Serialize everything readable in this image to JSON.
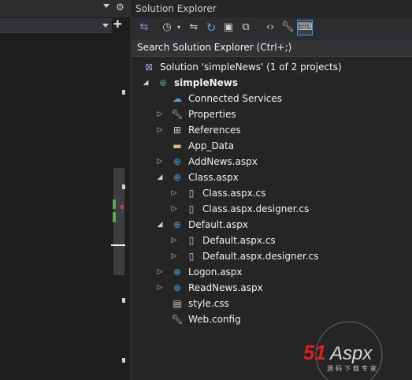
{
  "panel": {
    "title": "Solution Explorer",
    "search_placeholder": "Search Solution Explorer (Ctrl+;)"
  },
  "tree": [
    {
      "label": "Solution 'simpleNews' (1 of 2 projects)",
      "icon": "solution-icon",
      "level": 0,
      "expander": "none",
      "bold": false
    },
    {
      "label": "simpleNews",
      "icon": "web-project-icon",
      "level": 1,
      "expander": "expanded",
      "bold": true
    },
    {
      "label": "Connected Services",
      "icon": "connected-services-icon",
      "level": 2,
      "expander": "none",
      "bold": false
    },
    {
      "label": "Properties",
      "icon": "wrench-icon",
      "level": 2,
      "expander": "collapsed",
      "bold": false
    },
    {
      "label": "References",
      "icon": "references-icon",
      "level": 2,
      "expander": "collapsed",
      "bold": false
    },
    {
      "label": "App_Data",
      "icon": "folder-icon",
      "level": 2,
      "expander": "none",
      "bold": false
    },
    {
      "label": "AddNews.aspx",
      "icon": "web-file-icon",
      "level": 2,
      "expander": "collapsed",
      "bold": false
    },
    {
      "label": "Class.aspx",
      "icon": "web-file-icon",
      "level": 2,
      "expander": "expanded",
      "bold": false
    },
    {
      "label": "Class.aspx.cs",
      "icon": "cs-file-icon",
      "level": 3,
      "expander": "collapsed",
      "bold": false
    },
    {
      "label": "Class.aspx.designer.cs",
      "icon": "cs-file-icon",
      "level": 3,
      "expander": "collapsed",
      "bold": false
    },
    {
      "label": "Default.aspx",
      "icon": "web-file-icon",
      "level": 2,
      "expander": "expanded",
      "bold": false
    },
    {
      "label": "Default.aspx.cs",
      "icon": "cs-file-icon",
      "level": 3,
      "expander": "collapsed",
      "bold": false
    },
    {
      "label": "Default.aspx.designer.cs",
      "icon": "cs-file-icon",
      "level": 3,
      "expander": "collapsed",
      "bold": false
    },
    {
      "label": "Logon.aspx",
      "icon": "web-file-icon",
      "level": 2,
      "expander": "collapsed",
      "bold": false
    },
    {
      "label": "ReadNews.aspx",
      "icon": "web-file-icon",
      "level": 2,
      "expander": "collapsed",
      "bold": false
    },
    {
      "label": "style.css",
      "icon": "css-file-icon",
      "level": 2,
      "expander": "none",
      "bold": false
    },
    {
      "label": "Web.config",
      "icon": "config-file-icon",
      "level": 2,
      "expander": "none",
      "bold": false
    }
  ],
  "toolbar_icons": [
    "sync-with-document-icon",
    "history-icon",
    "dropdown-icon",
    "pending-changes-icon",
    "refresh-icon",
    "collapse-all-icon",
    "show-all-files-icon",
    "view-code-icon",
    "properties-icon",
    "preview-icon"
  ],
  "watermark": {
    "text": "51Aspx",
    "subtext": "源码下载专家"
  },
  "colors": {
    "background": "#252526",
    "text": "#f1f1f1",
    "accent": "#3399ff",
    "folder": "#dcb67a",
    "web": "#4aa3df"
  }
}
